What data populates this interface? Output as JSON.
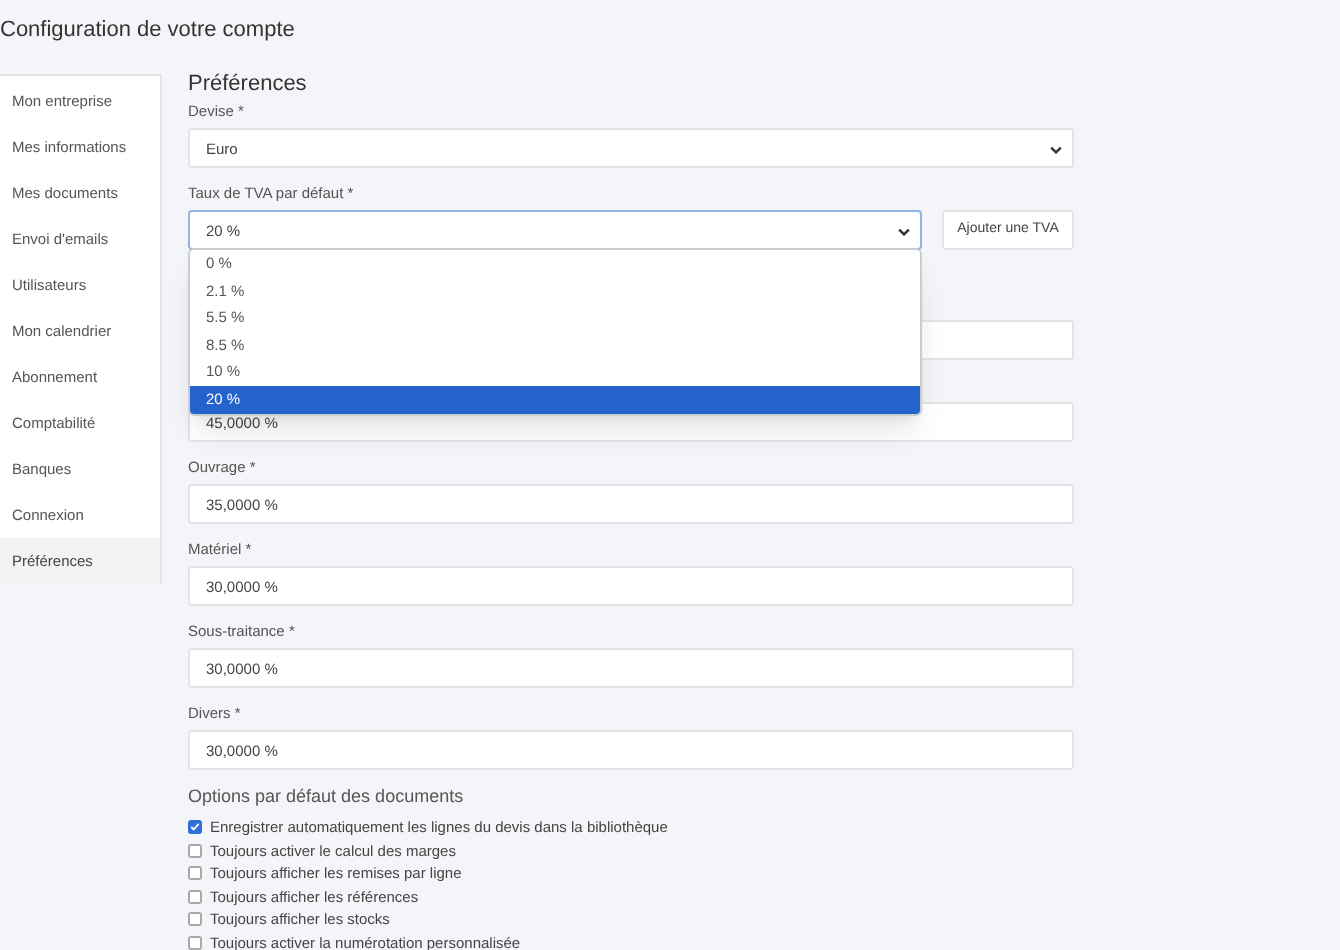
{
  "page_title": "Configuration de votre compte",
  "sidebar": {
    "items": [
      {
        "label": "Mon entreprise",
        "selected": false
      },
      {
        "label": "Mes informations",
        "selected": false
      },
      {
        "label": "Mes documents",
        "selected": false
      },
      {
        "label": "Envoi d'emails",
        "selected": false
      },
      {
        "label": "Utilisateurs",
        "selected": false
      },
      {
        "label": "Mon calendrier",
        "selected": false
      },
      {
        "label": "Abonnement",
        "selected": false
      },
      {
        "label": "Comptabilité",
        "selected": false
      },
      {
        "label": "Banques",
        "selected": false
      },
      {
        "label": "Connexion",
        "selected": false
      },
      {
        "label": "Préférences",
        "selected": true
      }
    ]
  },
  "section_title": "Préférences",
  "fields": [
    {
      "kind": "select",
      "label": "Devise *",
      "value": "Euro"
    },
    {
      "kind": "select",
      "label": "Taux de TVA par défaut *",
      "value": "20 %",
      "focused": true,
      "button": "Ajouter une TVA",
      "dropdown": [
        {
          "label": "0 %",
          "selected": false
        },
        {
          "label": "2.1 %",
          "selected": false
        },
        {
          "label": "5.5 %",
          "selected": false
        },
        {
          "label": "8.5 %",
          "selected": false
        },
        {
          "label": "10 %",
          "selected": false
        },
        {
          "label": "20 %",
          "selected": true
        }
      ]
    },
    {
      "kind": "input"
    },
    {
      "kind": "input",
      "value": "45,0000 %"
    },
    {
      "kind": "input",
      "label": "Ouvrage *",
      "value": "35,0000 %"
    },
    {
      "kind": "input",
      "label": "Matériel *",
      "value": "30,0000 %"
    },
    {
      "kind": "input",
      "label": "Sous-traitance *",
      "value": "30,0000 %"
    },
    {
      "kind": "input",
      "label": "Divers *",
      "value": "30,0000 %"
    }
  ],
  "options": {
    "title": "Options par défaut des documents",
    "items": [
      {
        "label": "Enregistrer automatiquement les lignes du devis dans la bibliothèque",
        "checked": true
      },
      {
        "label": "Toujours activer le calcul des marges",
        "checked": false
      },
      {
        "label": "Toujours afficher les remises par ligne",
        "checked": false
      },
      {
        "label": "Toujours afficher les références",
        "checked": false
      },
      {
        "label": "Toujours afficher les stocks",
        "checked": false
      },
      {
        "label": "Toujours activer la numérotation personnalisée",
        "checked": false
      }
    ]
  }
}
